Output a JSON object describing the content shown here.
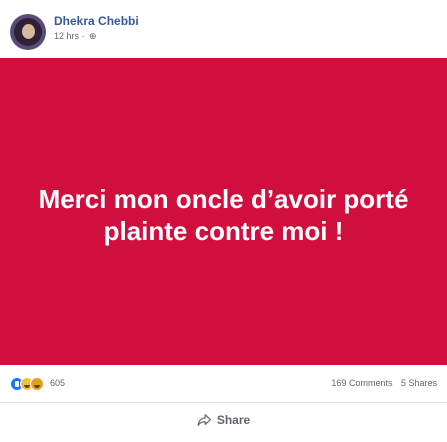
{
  "post": {
    "author": "Dhekra Chebbi",
    "time": "12 hrs",
    "separator": "·",
    "privacy_icon": "globe-icon",
    "text": "Merci mon oncle d’avoir porté plainte contre moi !",
    "background_color": "#d10f3f"
  },
  "stats": {
    "reaction_icons": [
      "like-icon",
      "wow-icon",
      "haha-icon"
    ],
    "reaction_count": "605",
    "comments": "169 Comments",
    "shares": "5 Shares"
  },
  "actions": {
    "share_label": "Share",
    "share_icon": "share-arrow-icon"
  }
}
